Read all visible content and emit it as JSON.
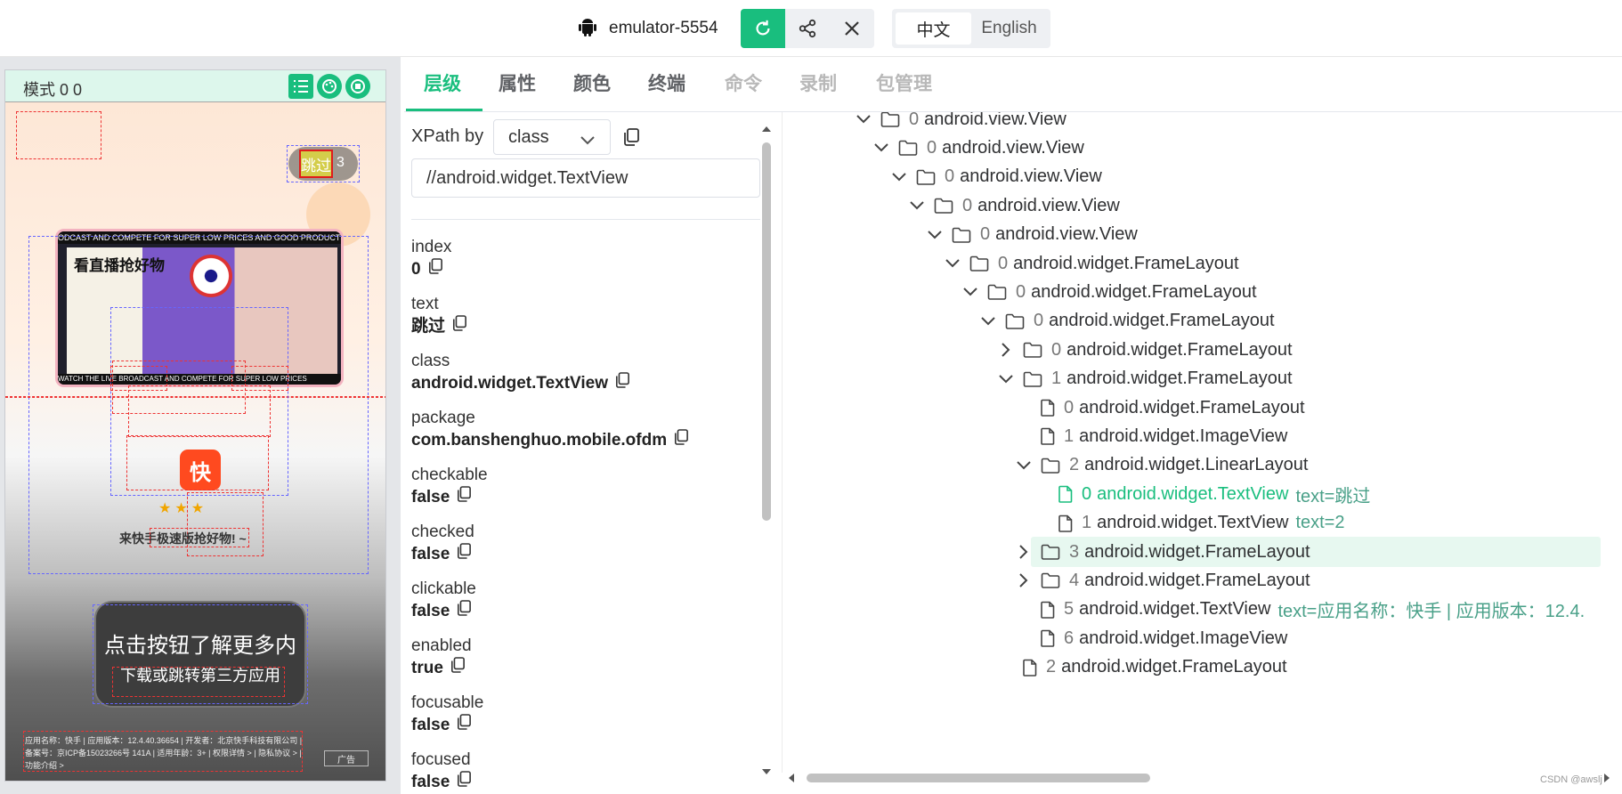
{
  "header": {
    "device_name": "emulator-5554",
    "lang_zh": "中文",
    "lang_en": "English"
  },
  "phone": {
    "mode_label": "模式 0 0",
    "skip_label": "跳过",
    "skip_count": "3",
    "banner_top": "ODCAST AND COMPETE FOR SUPER LOW PRICES AND GOOD PRODUCTS",
    "banner_title": "看直播抢好物",
    "banner_bottom": "WATCH THE LIVE BROADCAST AND COMPETE FOR SUPER LOW PRICES",
    "app_icon_char": "快",
    "cta_prompt": "来快手极速版抢好物! ~",
    "cta_main": "点击按钮了解更多内",
    "cta_sub": "下载或跳转第三方应用",
    "app_info": "应用名称：快手 | 应用版本：12.4.40.36654 | 开发者：北京快手科技有限公司 | 备案号：京ICP备15023266号 141A | 适用年龄：3+ | 权限详情 > | 隐私协议 > | 功能介绍 >",
    "ad_label": "广告"
  },
  "tabs": [
    {
      "label": "层级",
      "state": "active"
    },
    {
      "label": "属性",
      "state": "normal"
    },
    {
      "label": "颜色",
      "state": "normal"
    },
    {
      "label": "终端",
      "state": "normal"
    },
    {
      "label": "命令",
      "state": "disabled"
    },
    {
      "label": "录制",
      "state": "disabled"
    },
    {
      "label": "包管理",
      "state": "disabled"
    }
  ],
  "props": {
    "xpath_label": "XPath by",
    "xpath_mode": "class",
    "xpath_value": "//android.widget.TextView",
    "items": [
      {
        "label": "index",
        "value": "0"
      },
      {
        "label": "text",
        "value": "跳过"
      },
      {
        "label": "class",
        "value": "android.widget.TextView"
      },
      {
        "label": "package",
        "value": "com.banshenghuo.mobile.ofdm"
      },
      {
        "label": "checkable",
        "value": "false"
      },
      {
        "label": "checked",
        "value": "false"
      },
      {
        "label": "clickable",
        "value": "false"
      },
      {
        "label": "enabled",
        "value": "true"
      },
      {
        "label": "focusable",
        "value": "false"
      },
      {
        "label": "focused",
        "value": "false"
      }
    ]
  },
  "tree": [
    {
      "caret": "down",
      "type": "folder",
      "idx": "0",
      "cls": "android.view.View",
      "attr": ""
    },
    {
      "caret": "down",
      "type": "folder",
      "idx": "0",
      "cls": "android.view.View",
      "attr": ""
    },
    {
      "caret": "down",
      "type": "folder",
      "idx": "0",
      "cls": "android.view.View",
      "attr": ""
    },
    {
      "caret": "down",
      "type": "folder",
      "idx": "0",
      "cls": "android.view.View",
      "attr": ""
    },
    {
      "caret": "down",
      "type": "folder",
      "idx": "0",
      "cls": "android.view.View",
      "attr": ""
    },
    {
      "caret": "down",
      "type": "folder",
      "idx": "0",
      "cls": "android.widget.FrameLayout",
      "attr": ""
    },
    {
      "caret": "down",
      "type": "folder",
      "idx": "0",
      "cls": "android.widget.FrameLayout",
      "attr": ""
    },
    {
      "caret": "down",
      "type": "folder",
      "idx": "0",
      "cls": "android.widget.FrameLayout",
      "attr": ""
    },
    {
      "caret": "right",
      "type": "folder",
      "idx": "0",
      "cls": "android.widget.FrameLayout",
      "attr": ""
    },
    {
      "caret": "down",
      "type": "folder",
      "idx": "1",
      "cls": "android.widget.FrameLayout",
      "attr": ""
    },
    {
      "caret": "none",
      "type": "file",
      "idx": "0",
      "cls": "android.widget.FrameLayout",
      "attr": ""
    },
    {
      "caret": "none",
      "type": "file",
      "idx": "1",
      "cls": "android.widget.ImageView",
      "attr": ""
    },
    {
      "caret": "down",
      "type": "folder",
      "idx": "2",
      "cls": "android.widget.LinearLayout",
      "attr": ""
    },
    {
      "caret": "none",
      "type": "file",
      "idx": "0",
      "cls": "android.widget.TextView",
      "attr": "text=跳过",
      "selected": true
    },
    {
      "caret": "none",
      "type": "file",
      "idx": "1",
      "cls": "android.widget.TextView",
      "attr": "text=2"
    },
    {
      "caret": "right",
      "type": "folder",
      "idx": "3",
      "cls": "android.widget.FrameLayout",
      "attr": ""
    },
    {
      "caret": "right",
      "type": "folder",
      "idx": "4",
      "cls": "android.widget.FrameLayout",
      "attr": ""
    },
    {
      "caret": "none",
      "type": "file",
      "idx": "5",
      "cls": "android.widget.TextView",
      "attr": "text=应用名称：快手 | 应用版本：12.4."
    },
    {
      "caret": "none",
      "type": "file",
      "idx": "6",
      "cls": "android.widget.ImageView",
      "attr": ""
    },
    {
      "caret": "none",
      "type": "file",
      "idx": "2",
      "cls": "android.widget.FrameLayout",
      "attr": ""
    }
  ],
  "footer": {
    "watermark": "CSDN @awslj"
  },
  "colors": {
    "accent": "#19be7e",
    "selected_row_bg": "#e7f8f0",
    "attr_text": "#49a088"
  }
}
